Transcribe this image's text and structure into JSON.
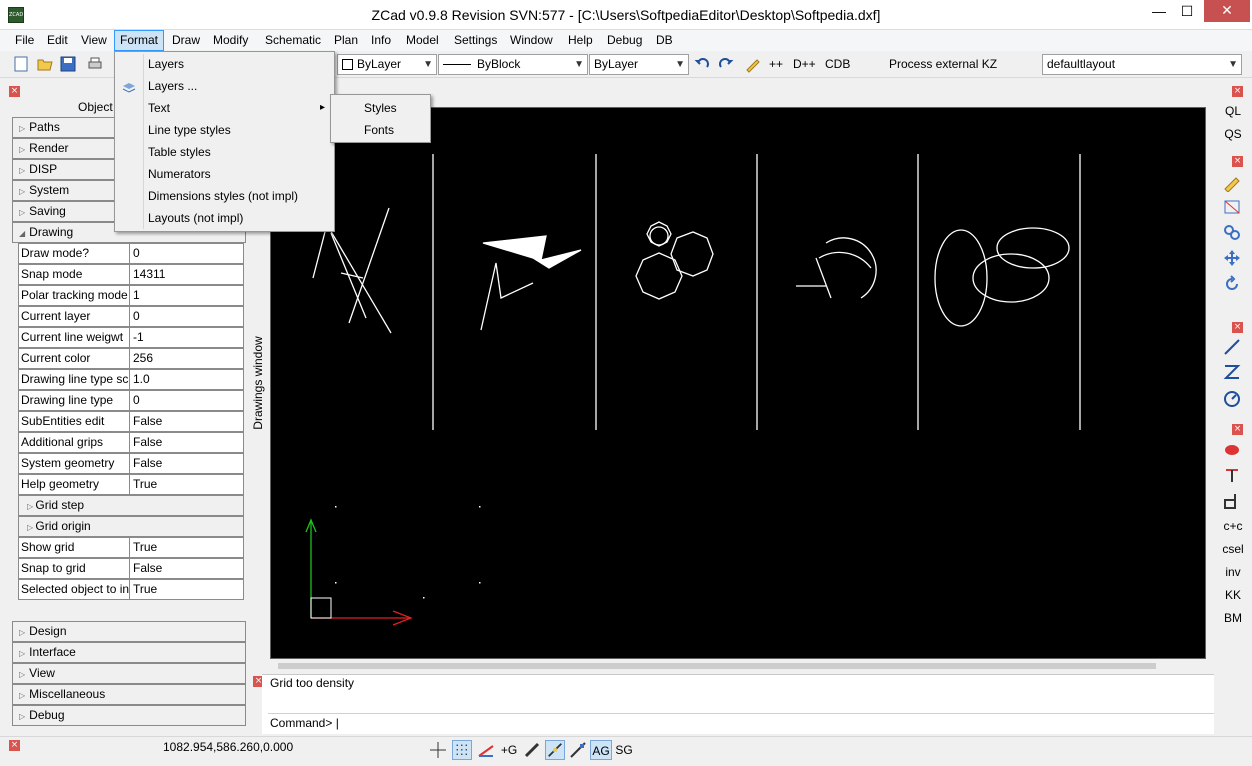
{
  "window": {
    "title": "ZCad v0.9.8 Revision SVN:577 - [C:\\Users\\SoftpediaEditor\\Desktop\\Softpedia.dxf]",
    "app_icon_text": "ZCAD",
    "min_glyph": "—",
    "max_glyph": "☐",
    "close_glyph": "✕"
  },
  "menubar": [
    "File",
    "Edit",
    "View",
    "Format",
    "Draw",
    "Modify",
    "Schematic",
    "Plan",
    "Info",
    "Model",
    "Settings",
    "Window",
    "Help",
    "Debug",
    "DB"
  ],
  "format_menu": {
    "items": [
      "Layers",
      "Layers ...",
      "Text",
      "Line type styles",
      "Table styles",
      "Numerators",
      "Dimensions styles (not impl)",
      "Layouts (not impl)"
    ],
    "submenu_arrow": "▸",
    "text_submenu": [
      "Styles",
      "Fonts"
    ]
  },
  "toolbar": {
    "layer_combo": "ByLayer",
    "linetype_combo": "ByBlock",
    "lineweight_combo": "ByLayer",
    "buttons": [
      "++",
      "D++",
      "CDB"
    ],
    "process_label": "Process external KZ",
    "layout_combo": "defaultlayout"
  },
  "left_panel": {
    "title": "Object",
    "top_sections": [
      "Paths",
      "Render",
      "DISP",
      "System",
      "Saving",
      "Drawing"
    ],
    "properties": [
      {
        "k": "Draw mode?",
        "v": "0"
      },
      {
        "k": "Snap mode",
        "v": "14311"
      },
      {
        "k": "Polar tracking mode",
        "v": "1"
      },
      {
        "k": "Current layer",
        "v": "0"
      },
      {
        "k": "Current line weigwt",
        "v": "-1"
      },
      {
        "k": "Current color",
        "v": "256"
      },
      {
        "k": "Drawing line type sca",
        "v": "1.0"
      },
      {
        "k": "Drawing line type",
        "v": "0"
      },
      {
        "k": "SubEntities edit",
        "v": "False"
      },
      {
        "k": "Additional grips",
        "v": "False"
      },
      {
        "k": "System geometry",
        "v": "False"
      },
      {
        "k": "Help geometry",
        "v": "True"
      }
    ],
    "grid_sub": [
      "Grid step",
      "Grid origin"
    ],
    "properties2": [
      {
        "k": "Show grid",
        "v": "True"
      },
      {
        "k": "Snap to grid",
        "v": "False"
      },
      {
        "k": "Selected object to ins",
        "v": "True"
      }
    ],
    "bottom_sections": [
      "Design",
      "Interface",
      "View",
      "Miscellaneous",
      "Debug"
    ]
  },
  "drawings_window_label": "Drawings window",
  "command": {
    "message": "Grid too density",
    "prompt": "Command>"
  },
  "status": {
    "coords": "1082.954,586.260,0.000",
    "buttons": [
      "+G",
      "AG",
      "SG"
    ]
  },
  "right_toolbar": [
    "QL",
    "QS",
    "c+c",
    "csel",
    "inv",
    "KK",
    "BM"
  ],
  "colors": {
    "canvas": "#000000",
    "menu_highlight": "#cde4f7",
    "axis_x": "#e02020",
    "axis_y": "#20c020"
  },
  "icons": [
    "new-file-icon",
    "open-folder-icon",
    "save-icon",
    "print-icon",
    "undo-icon",
    "redo-icon",
    "pen-icon",
    "layers-icon"
  ]
}
